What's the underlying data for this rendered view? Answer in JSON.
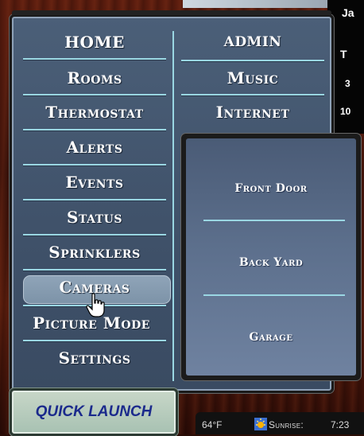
{
  "menu": {
    "left": [
      "HOME",
      "Rooms",
      "Thermostat",
      "Alerts",
      "Events",
      "Status",
      "Sprinklers",
      "Cameras",
      "Picture Mode",
      "Settings"
    ],
    "right": [
      "ADMIN",
      "Music",
      "Internet"
    ],
    "selected": "Cameras"
  },
  "submenu": {
    "items": [
      "Front Door",
      "Back Yard",
      "Garage"
    ]
  },
  "quick_launch": {
    "label": "QUICK LAUNCH"
  },
  "calendar": {
    "month": "Ja",
    "day_initial": "T",
    "row1": "3",
    "row2": "10"
  },
  "status": {
    "temp": "64°F",
    "sunrise_label": "Sunrise:",
    "sunrise_time": "7:23"
  },
  "colors": {
    "accent_line": "#9ad7e3",
    "quick_launch_text": "#1b2a8c"
  }
}
